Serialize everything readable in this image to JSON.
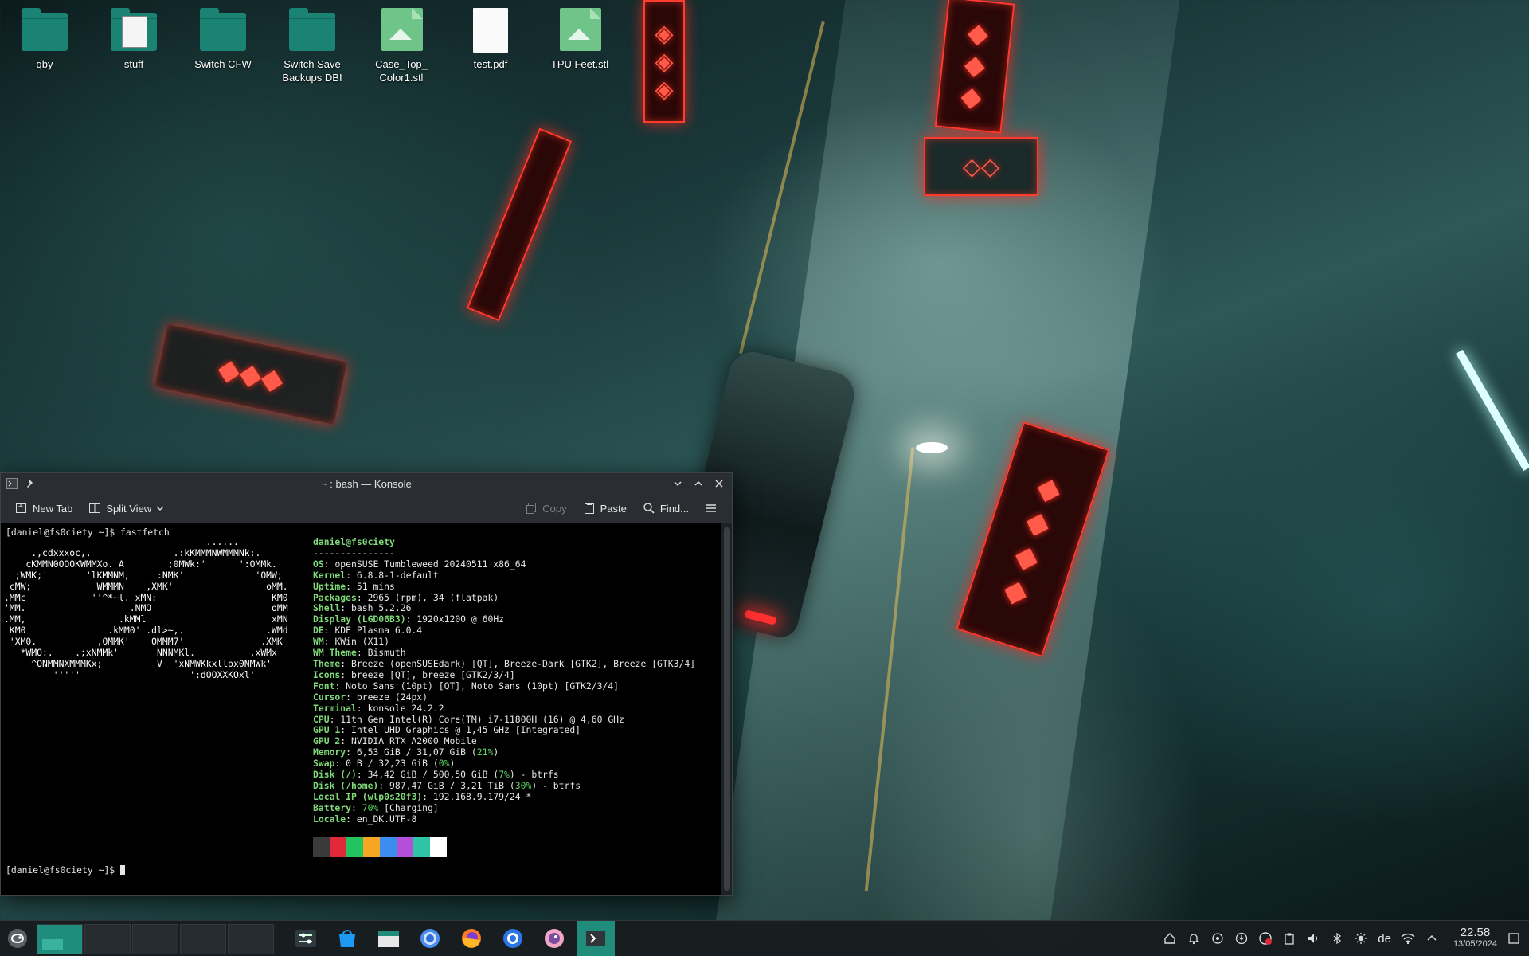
{
  "desktop": {
    "icons": [
      {
        "label": "qby",
        "type": "folder"
      },
      {
        "label": "stuff",
        "type": "folder-image"
      },
      {
        "label": "Switch CFW",
        "type": "folder"
      },
      {
        "label": "Switch Save Backups DBI",
        "type": "folder"
      },
      {
        "label": "Case_Top_ Color1.stl",
        "type": "stl"
      },
      {
        "label": "test.pdf",
        "type": "pdf"
      },
      {
        "label": "TPU Feet.stl",
        "type": "stl"
      }
    ]
  },
  "konsole": {
    "title": "~ : bash — Konsole",
    "toolbar": {
      "new_tab": "New Tab",
      "split_view": "Split View",
      "copy": "Copy",
      "paste": "Paste",
      "find": "Find..."
    },
    "prompt": "[daniel@fs0ciety ~]$ fastfetch",
    "prompt_end": "[daniel@fs0ciety ~]$ ",
    "logo_lines": [
      "                                     ......",
      "     .,cdxxxoc,.               .:kKMMMNWMMMNk:.",
      "    cKMMN0OOOKWMMXo. A        ;0MWk:'      ':OMMk.",
      "  ;WMK;'       'lKMMNM,     :NMK'             'OMW;",
      " cMW;            WMMMN    ,XMK'                 oMM.",
      ".MMc            ''^*~l. xMN:                     KM0",
      "'MM.                   .NMO                      oMM",
      ".MM,                 .kMMl                       xMN",
      " KM0               .kMM0' .dl>~,.               .WMd",
      " 'XM0.           ,OMMK'    OMMM7'              .XMK",
      "   *WMO:.    .;xNMMk'       NNNMKl.          .xWMx",
      "     ^ONMMNXMMMKx;          V  'xNMWKkxllox0NMWk'",
      "         '''''                    ':dOOXXKOxl'"
    ],
    "user_host": "daniel@fs0ciety",
    "separator": "---------------",
    "info": [
      {
        "key": "OS",
        "value": "openSUSE Tumbleweed 20240511 x86_64"
      },
      {
        "key": "Kernel",
        "value": "6.8.8-1-default"
      },
      {
        "key": "Uptime",
        "value": "51 mins"
      },
      {
        "key": "Packages",
        "value": "2965 (rpm), 34 (flatpak)"
      },
      {
        "key": "Shell",
        "value": "bash 5.2.26"
      },
      {
        "key": "Display (LGD06B3)",
        "value": "1920x1200 @ 60Hz"
      },
      {
        "key": "DE",
        "value": "KDE Plasma 6.0.4"
      },
      {
        "key": "WM",
        "value": "KWin (X11)"
      },
      {
        "key": "WM Theme",
        "value": "Bismuth"
      },
      {
        "key": "Theme",
        "value": "Breeze (openSUSEdark) [QT], Breeze-Dark [GTK2], Breeze [GTK3/4]"
      },
      {
        "key": "Icons",
        "value": "breeze [QT], breeze [GTK2/3/4]"
      },
      {
        "key": "Font",
        "value": "Noto Sans (10pt) [QT], Noto Sans (10pt) [GTK2/3/4]"
      },
      {
        "key": "Cursor",
        "value": "breeze (24px)"
      },
      {
        "key": "Terminal",
        "value": "konsole 24.2.2"
      },
      {
        "key": "CPU",
        "value": "11th Gen Intel(R) Core(TM) i7-11800H (16) @ 4,60 GHz"
      },
      {
        "key": "GPU 1",
        "value": "Intel UHD Graphics @ 1,45 GHz [Integrated]"
      },
      {
        "key": "GPU 2",
        "value": "NVIDIA RTX A2000 Mobile"
      },
      {
        "key": "Memory",
        "value": "6,53 GiB / 31,07 GiB (",
        "pct": "21%",
        "tail": ")"
      },
      {
        "key": "Swap",
        "value": "0 B / 32,23 GiB (",
        "pct": "0%",
        "tail": ")"
      },
      {
        "key": "Disk (/)",
        "value": "34,42 GiB / 500,50 GiB (",
        "pct": "7%",
        "tail": ") - btrfs"
      },
      {
        "key": "Disk (/home)",
        "value": "987,47 GiB / 3,21 TiB (",
        "pct": "30%",
        "tail": ") - btrfs"
      },
      {
        "key": "Local IP (wlp0s20f3)",
        "value": "192.168.9.179/24 *"
      },
      {
        "key": "Battery",
        "value": "",
        "pct": "70%",
        "tail": " [Charging]"
      },
      {
        "key": "Locale",
        "value": "en_DK.UTF-8"
      }
    ],
    "palette": [
      "#3a3a3a",
      "#e0293a",
      "#23c35e",
      "#f5a623",
      "#3b8ef0",
      "#b44fd9",
      "#2ec4a5",
      "#ffffff"
    ]
  },
  "taskbar": {
    "keyboard_layout": "de",
    "time": "22.58",
    "date": "13/05/2024"
  },
  "colors": {
    "accent": "#1f8c7c",
    "neon": "#ff3b30"
  }
}
